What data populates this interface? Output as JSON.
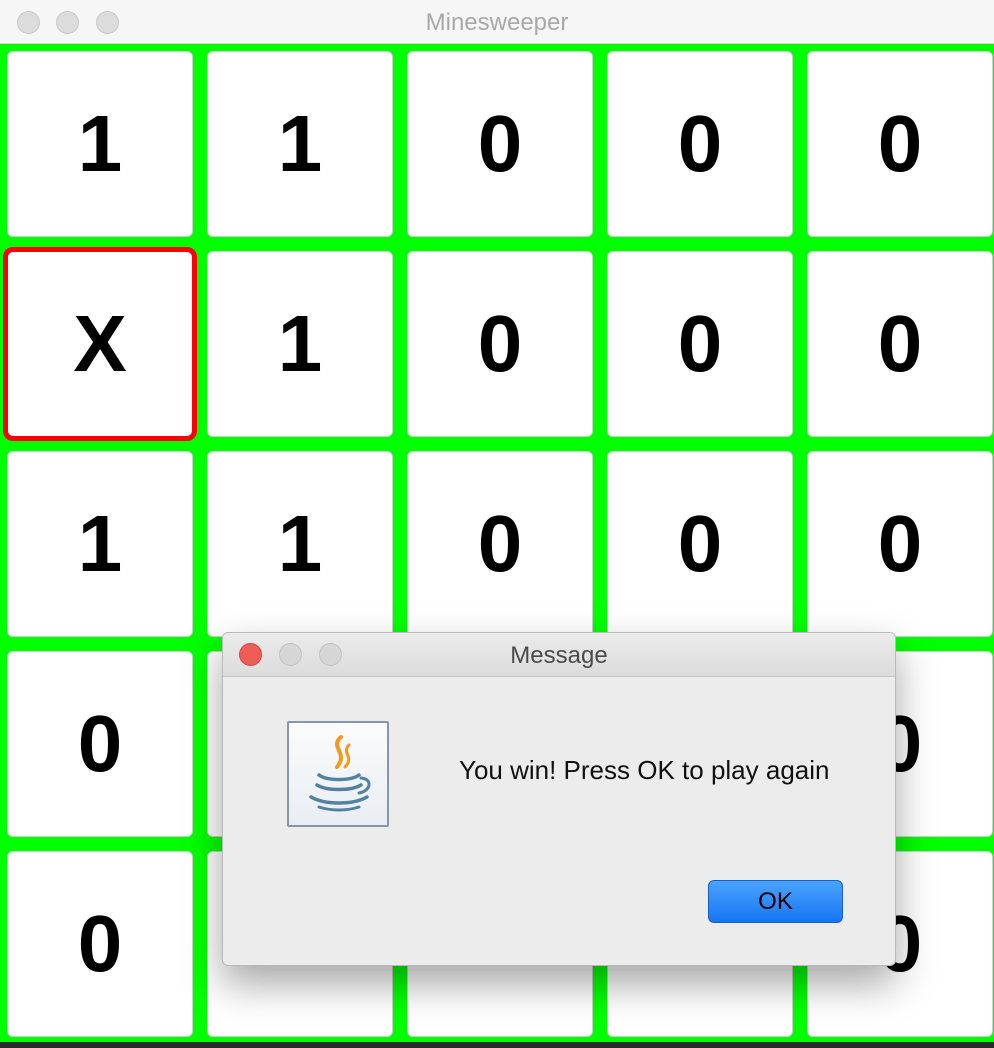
{
  "window": {
    "title": "Minesweeper"
  },
  "board": {
    "colors": {
      "background": "#00ff00",
      "selected_border": "#ff0000"
    },
    "rows": [
      [
        "1",
        "1",
        "0",
        "0",
        "0"
      ],
      [
        "X",
        "1",
        "0",
        "0",
        "0"
      ],
      [
        "1",
        "1",
        "0",
        "0",
        "0"
      ],
      [
        "0",
        "",
        "",
        "",
        "0"
      ],
      [
        "0",
        "",
        "",
        "",
        "0"
      ]
    ],
    "selected_cell": {
      "row": 1,
      "col": 0
    }
  },
  "dialog": {
    "title": "Message",
    "icon": "java-icon",
    "message": "You win! Press OK to play again",
    "ok_label": "OK"
  }
}
